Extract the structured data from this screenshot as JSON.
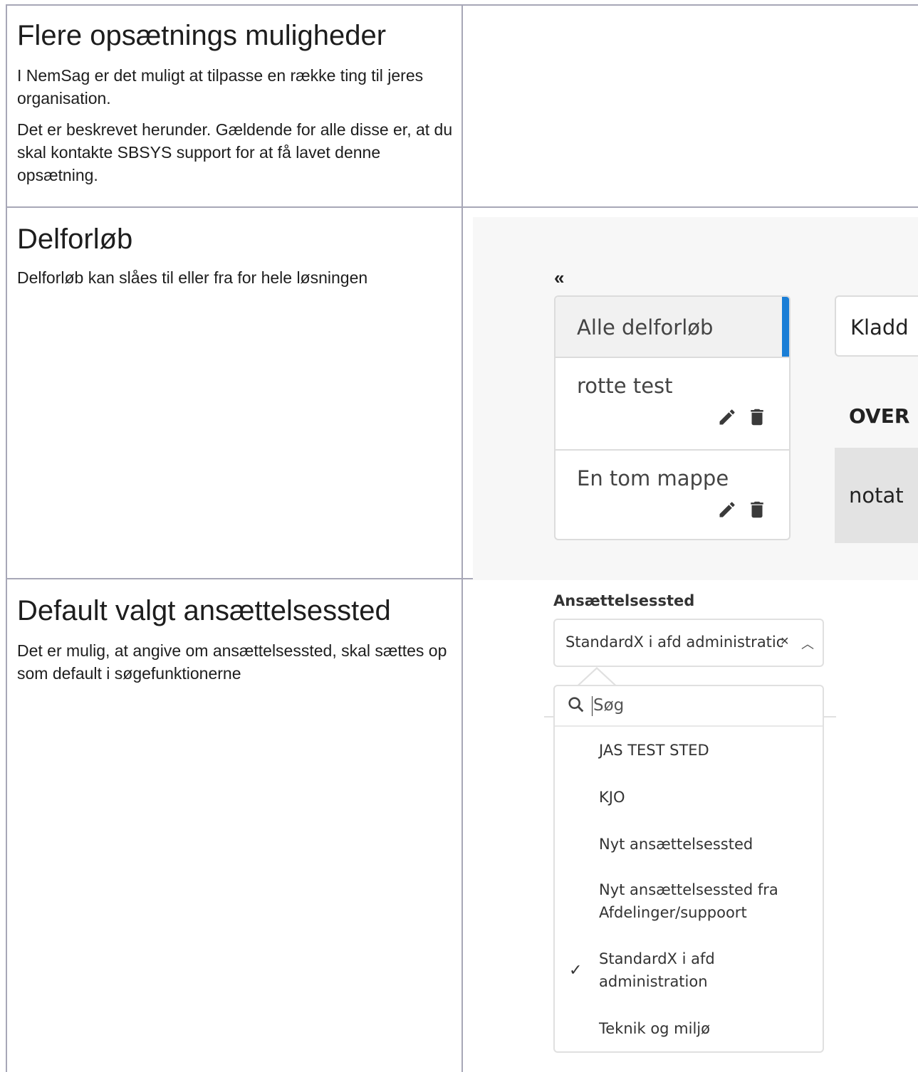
{
  "sections": {
    "intro": {
      "title": "Flere opsætnings muligheder",
      "p1": "I NemSag er det muligt at tilpasse en række ting til jeres organisation.",
      "p2": "Det er beskrevet herunder. Gældende for alle disse er, at du skal kontakte SBSYS support for at få lavet denne opsætning."
    },
    "delforlob": {
      "title": "Delforløb",
      "p1": "Delforløb kan slåes til eller fra for hele løsningen"
    },
    "default_ansat": {
      "title": "Default valgt ansættelsessted",
      "p1": "Det er mulig, at angive om ansættelsessted, skal sættes op som default i søgefunktionerne"
    }
  },
  "delforlob_shot": {
    "collapse_icon": "«",
    "items": [
      {
        "label": "Alle delforløb"
      },
      {
        "label": "rotte test"
      },
      {
        "label": "En tom mappe"
      }
    ],
    "kladde_label": "Kladd",
    "over_label": "OVER",
    "notat_label": "notat",
    "edit_icon": "pencil-icon",
    "delete_icon": "trash-icon"
  },
  "ansat_shot": {
    "label": "Ansættelsessted",
    "selected_value": "StandardX i afd administration",
    "clear_glyph": "×",
    "chevron_glyph": "︿",
    "search_placeholder": "Søg",
    "options": [
      "JAS TEST STED",
      "KJO",
      "Nyt ansættelsessted",
      "Nyt ansættelsessted fra Afdelinger/suppoort",
      "StandardX i afd administration",
      "Teknik og miljø"
    ],
    "checked_option_index": 4,
    "check_glyph": "✓",
    "accent_color": "#1a7ed6"
  }
}
